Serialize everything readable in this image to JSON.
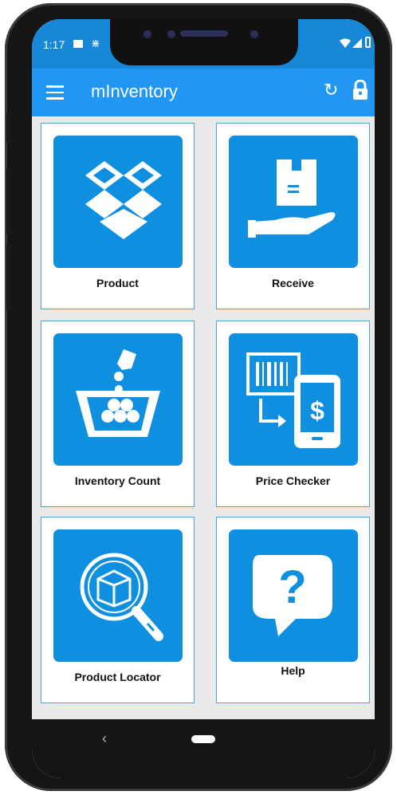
{
  "status": {
    "time": "1:17"
  },
  "app": {
    "title": "mInventory"
  },
  "tiles": [
    {
      "label": "Product",
      "icon": "open-box-icon"
    },
    {
      "label": "Receive",
      "icon": "hand-package-icon"
    },
    {
      "label": "Inventory Count",
      "icon": "basket-count-icon"
    },
    {
      "label": "Price Checker",
      "icon": "barcode-phone-icon"
    },
    {
      "label": "Product Locator",
      "icon": "magnifier-box-icon"
    },
    {
      "label": "Help",
      "icon": "question-bubble-icon"
    }
  ],
  "colors": {
    "appbar": "#2196f3",
    "tile": "#0e8fe0",
    "statusbar": "#1787d8"
  }
}
